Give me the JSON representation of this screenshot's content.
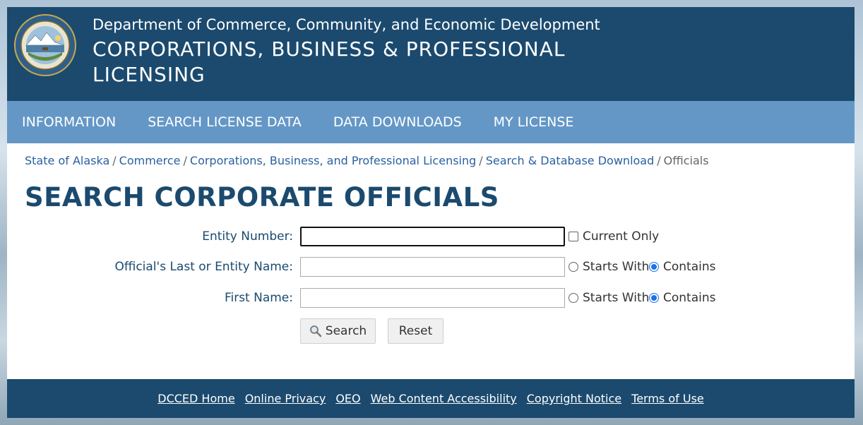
{
  "header": {
    "department": "Department of Commerce, Community, and Economic Development",
    "division": "CORPORATIONS, BUSINESS & PROFESSIONAL LICENSING",
    "seal_icon": "alaska-state-seal-icon"
  },
  "nav": {
    "items": [
      {
        "label": "INFORMATION"
      },
      {
        "label": "SEARCH LICENSE DATA"
      },
      {
        "label": "DATA DOWNLOADS"
      },
      {
        "label": "MY LICENSE"
      }
    ]
  },
  "breadcrumb": {
    "items": [
      {
        "label": "State of Alaska"
      },
      {
        "label": "Commerce"
      },
      {
        "label": "Corporations, Business, and Professional Licensing"
      },
      {
        "label": "Search & Database Download"
      }
    ],
    "current": "Officials"
  },
  "page_title": "SEARCH CORPORATE OFFICIALS",
  "form": {
    "entity_number": {
      "label": "Entity Number:",
      "value": "",
      "current_only_label": "Current Only",
      "current_only_checked": false
    },
    "last_name": {
      "label": "Official's Last or Entity Name:",
      "value": "",
      "starts_with_label": "Starts With",
      "contains_label": "Contains",
      "selected": "Contains"
    },
    "first_name": {
      "label": "First Name:",
      "value": "",
      "starts_with_label": "Starts With",
      "contains_label": "Contains",
      "selected": "Contains"
    },
    "search_label": "Search",
    "reset_label": "Reset"
  },
  "footer": {
    "links": [
      {
        "label": "DCCED Home"
      },
      {
        "label": "Online Privacy"
      },
      {
        "label": "OEO"
      },
      {
        "label": "Web Content Accessibility"
      },
      {
        "label": "Copyright Notice"
      },
      {
        "label": "Terms of Use"
      }
    ]
  },
  "colors": {
    "header_bg": "#1b4a6e",
    "nav_bg": "#6497c6",
    "link": "#2a5fa0",
    "radio_checked": "#1a73e8"
  }
}
